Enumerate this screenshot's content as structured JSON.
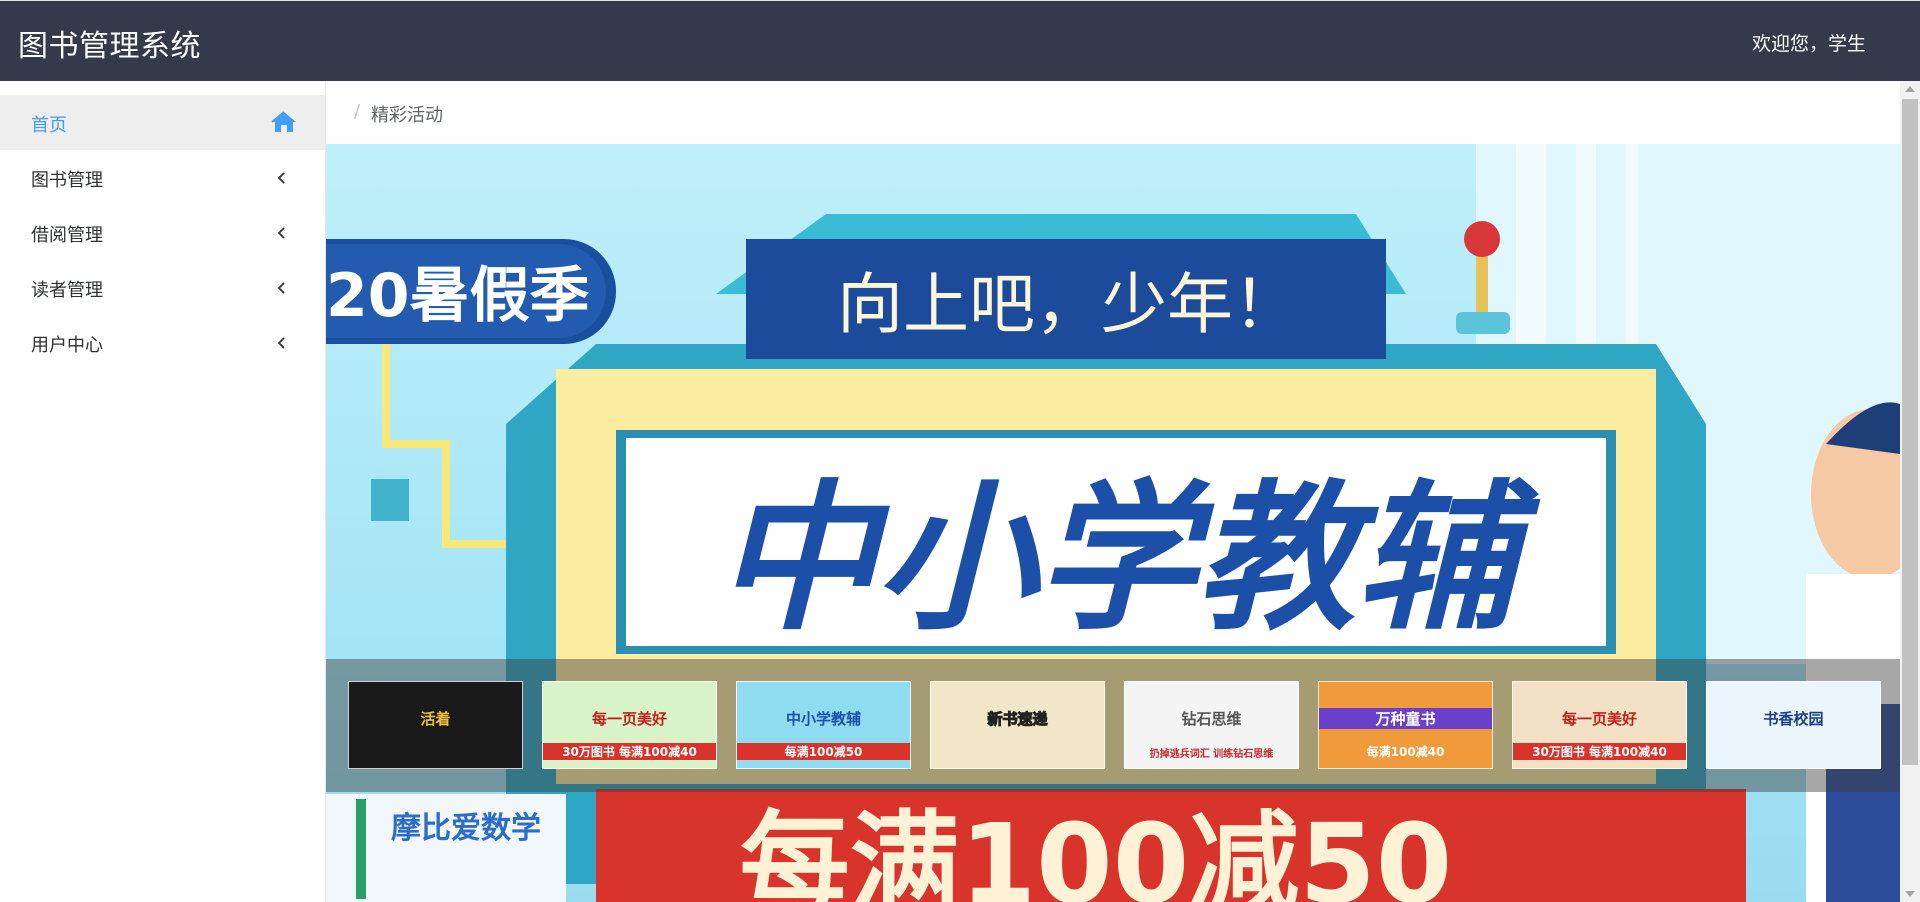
{
  "app": {
    "title": "图书管理系统",
    "welcome": "欢迎您，学生"
  },
  "sidebar": {
    "items": [
      {
        "label": "首页",
        "icon": "home-icon",
        "active": true
      },
      {
        "label": "图书管理",
        "icon": "chevron-left-icon"
      },
      {
        "label": "借阅管理",
        "icon": "chevron-left-icon"
      },
      {
        "label": "读者管理",
        "icon": "chevron-left-icon"
      },
      {
        "label": "用户中心",
        "icon": "chevron-left-icon"
      }
    ]
  },
  "breadcrumb": {
    "separator": "/",
    "current": "精彩活动"
  },
  "banner": {
    "season": "20暑假季",
    "slogan": "向上吧，少年！",
    "headline": "中小学教辅",
    "promo": "每满100减50",
    "book": "摩比爱数学"
  },
  "thumbnails": [
    {
      "text": "活着",
      "sub": ""
    },
    {
      "text": "每一页美好",
      "sub": "30万图书 每满100减40"
    },
    {
      "text": "中小学教辅",
      "sub": "每满100减50"
    },
    {
      "text": "新书速递",
      "sub": ""
    },
    {
      "text": "钻石思维",
      "sub": "扔掉逃兵词汇 训练钻石思维"
    },
    {
      "text": "万种童书",
      "sub": "每满100减40"
    },
    {
      "text": "每一页美好",
      "sub": "30万图书 每满100减40"
    },
    {
      "text": "书香校园",
      "sub": ""
    }
  ],
  "colors": {
    "header_bg": "#343a4a",
    "accent": "#409eff",
    "promo_red": "#d9342b",
    "headline_blue": "#1c4fa8"
  }
}
